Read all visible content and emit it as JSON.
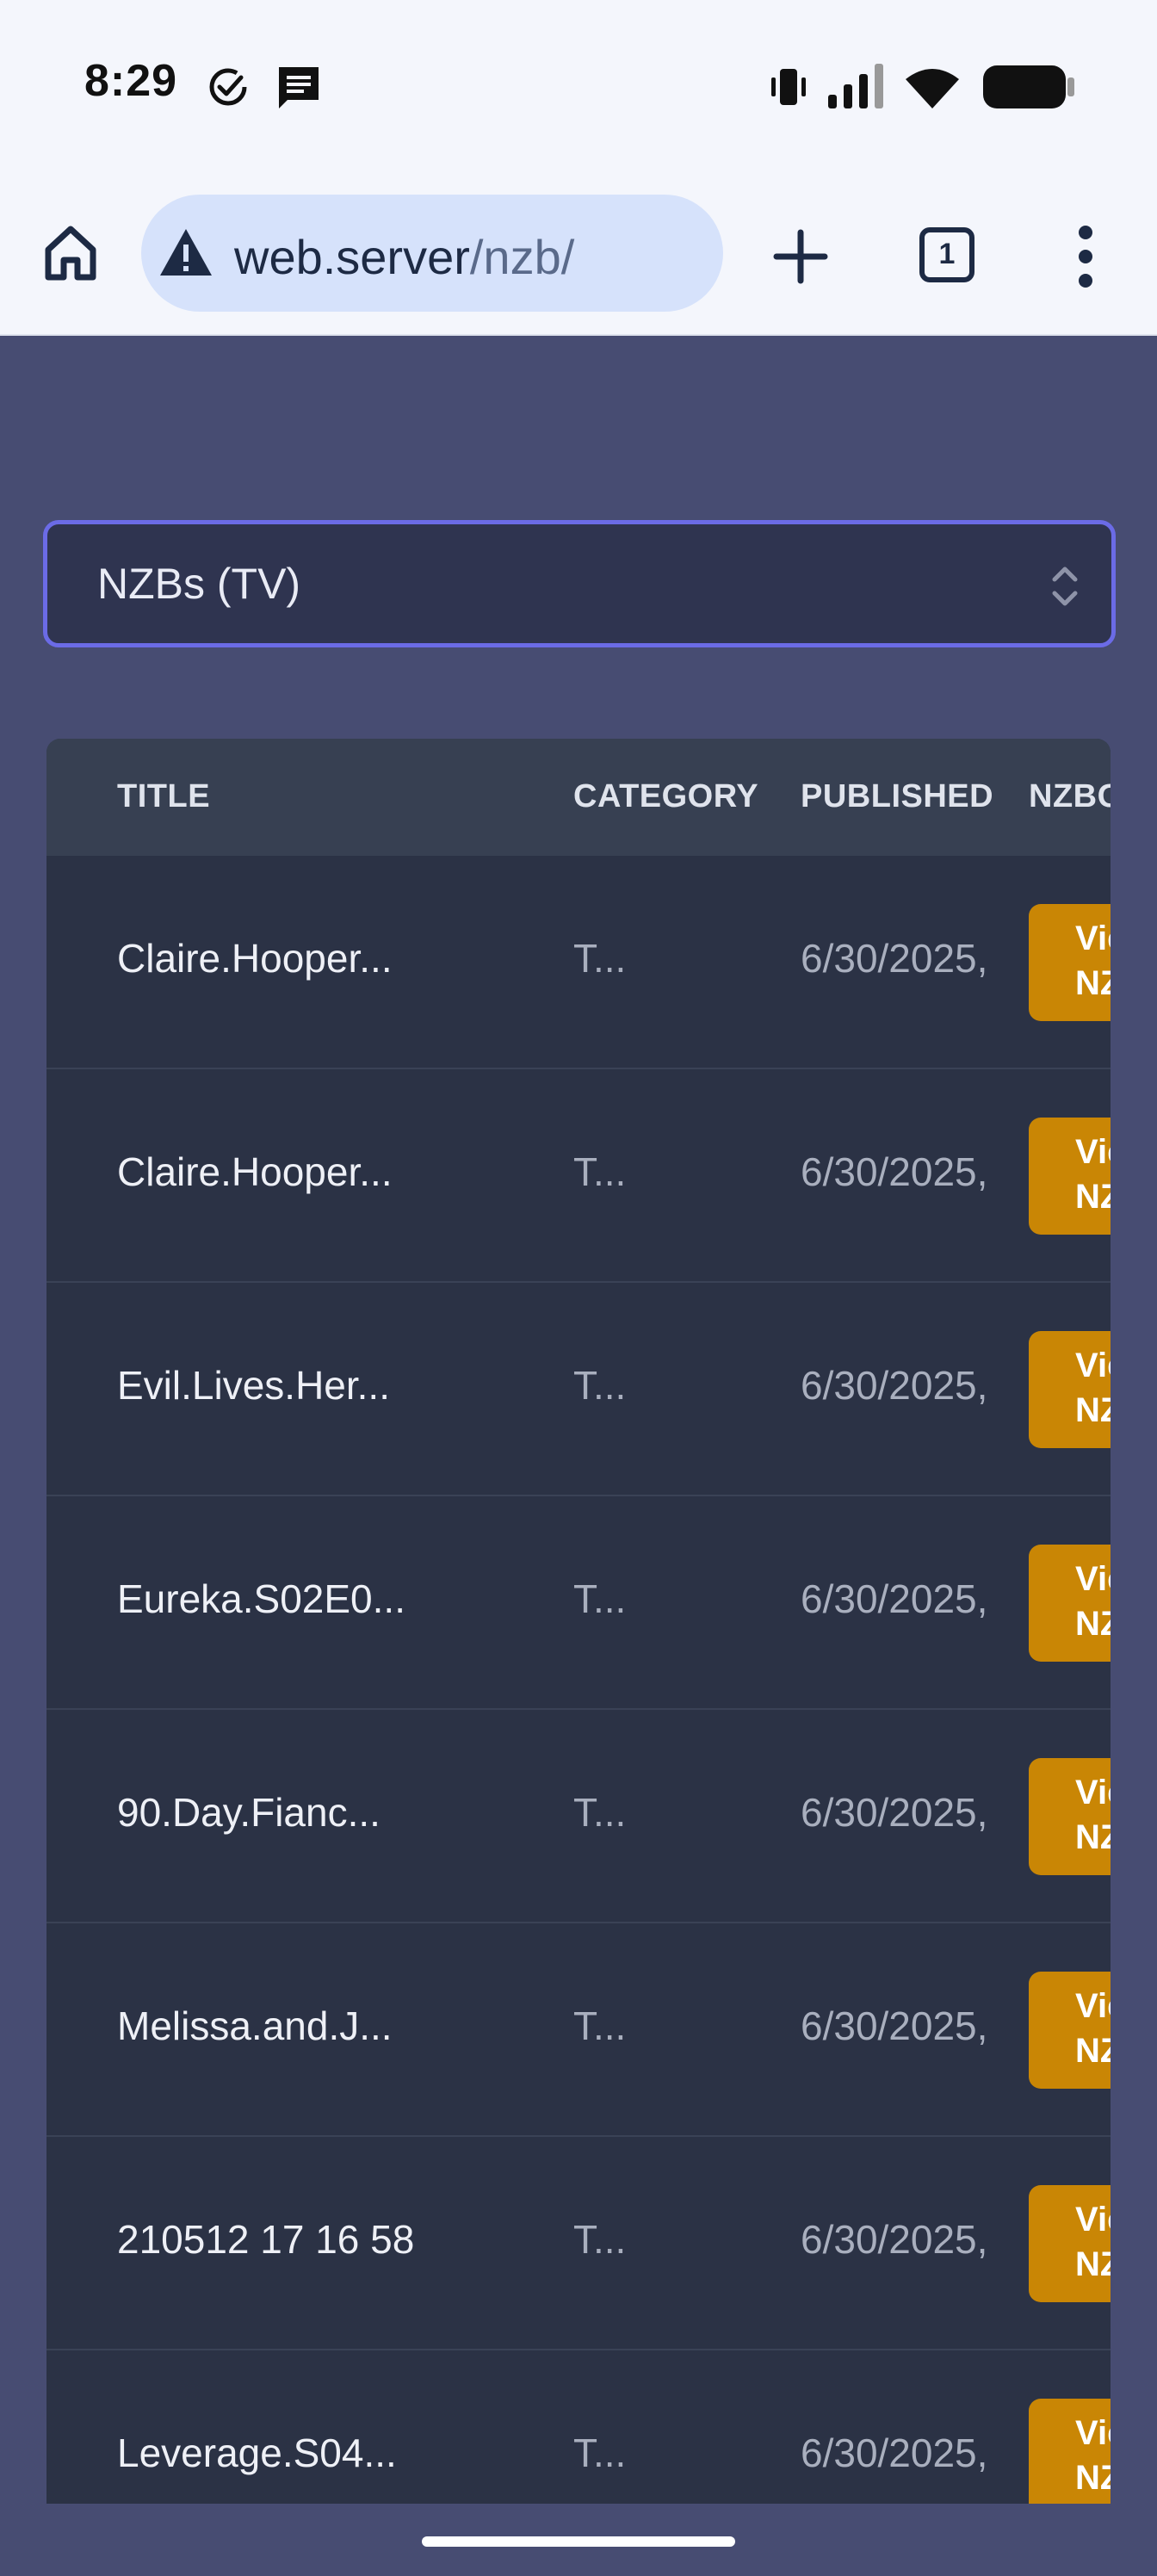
{
  "status_bar": {
    "time": "8:29",
    "icons": [
      "check-circle-icon",
      "message-icon",
      "vibrate-icon",
      "signal-icon",
      "wifi-icon",
      "battery-icon"
    ]
  },
  "browser": {
    "url_host": "web.server",
    "url_path": "/nzb/",
    "tab_count": "1",
    "icons": [
      "home-icon",
      "warning-icon",
      "new-tab-icon",
      "tab-switcher-icon",
      "more-icon"
    ]
  },
  "feed_select": {
    "value": "NZBs (TV)"
  },
  "table": {
    "headers": {
      "title": "TITLE",
      "category": "CATEGORY",
      "published": "PUBLISHED",
      "nzbget": "NZBGE"
    },
    "rows": [
      {
        "title": "Claire.Hooper...",
        "category": "T...",
        "published": "6/30/2025,",
        "button_line1": "View",
        "button_line2": "NZBG"
      },
      {
        "title": "Claire.Hooper...",
        "category": "T...",
        "published": "6/30/2025,",
        "button_line1": "View",
        "button_line2": "NZBG"
      },
      {
        "title": "Evil.Lives.Her...",
        "category": "T...",
        "published": "6/30/2025,",
        "button_line1": "View",
        "button_line2": "NZBG"
      },
      {
        "title": "Eureka.S02E0...",
        "category": "T...",
        "published": "6/30/2025,",
        "button_line1": "View",
        "button_line2": "NZBG"
      },
      {
        "title": "90.Day.Fianc...",
        "category": "T...",
        "published": "6/30/2025,",
        "button_line1": "View",
        "button_line2": "NZBG"
      },
      {
        "title": "Melissa.and.J...",
        "category": "T...",
        "published": "6/30/2025,",
        "button_line1": "View",
        "button_line2": "NZBG"
      },
      {
        "title": "210512 17 16 58",
        "category": "T...",
        "published": "6/30/2025,",
        "button_line1": "View",
        "button_line2": "NZBG"
      },
      {
        "title": "Leverage.S04...",
        "category": "T...",
        "published": "6/30/2025,",
        "button_line1": "View",
        "button_line2": "NZBG"
      }
    ]
  },
  "colors": {
    "page_bg": "#474c72",
    "table_bg": "#2b3245",
    "header_bg": "#374052",
    "accent_button": "#c98605",
    "select_border": "#6b6be6"
  }
}
